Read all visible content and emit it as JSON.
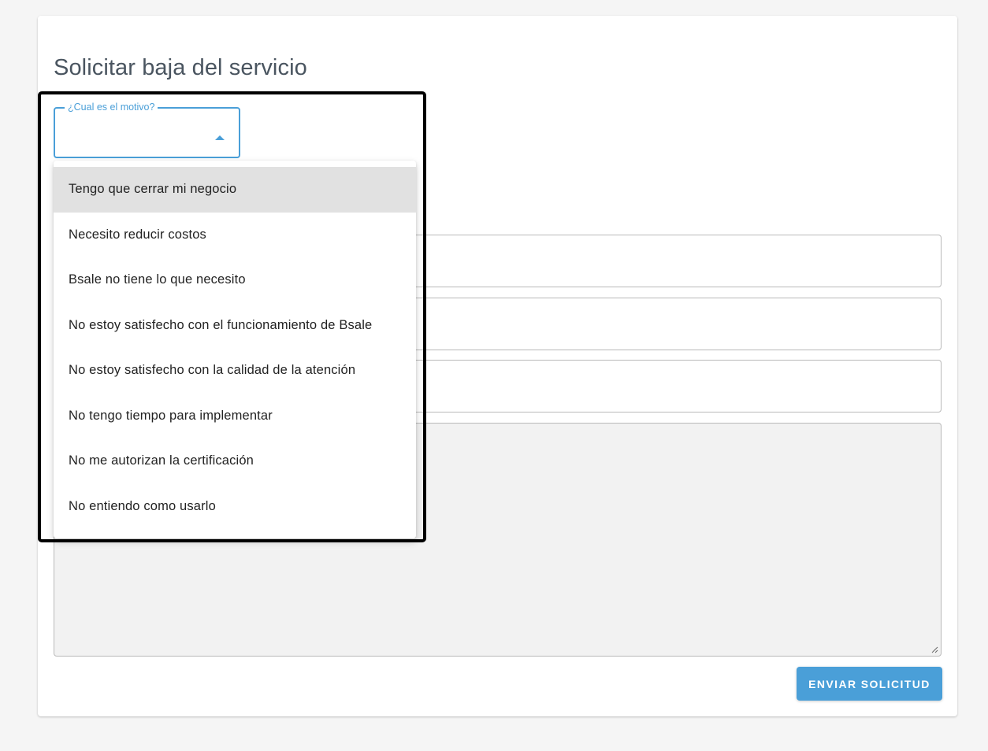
{
  "page": {
    "title": "Solicitar baja del servicio"
  },
  "reason_select": {
    "label": "¿Cual es el motivo?",
    "value": "",
    "options": [
      "Tengo que cerrar mi negocio",
      "Necesito reducir costos",
      "Bsale no tiene lo que necesito",
      "No estoy satisfecho con el funcionamiento de Bsale",
      "No estoy satisfecho con la calidad de la atención",
      "No tengo tiempo para implementar",
      "No me autorizan la certificación",
      "No entiendo como usarlo"
    ],
    "highlighted_index": 0
  },
  "actions": {
    "submit_label": "ENVIAR SOLICITUD"
  },
  "colors": {
    "accent": "#4a9fd8",
    "title": "#4a5560",
    "highlight": "#e1e1e1"
  },
  "icons": {
    "select_caret": "caret-up-icon",
    "textarea_grip": "resize-grip-icon"
  }
}
